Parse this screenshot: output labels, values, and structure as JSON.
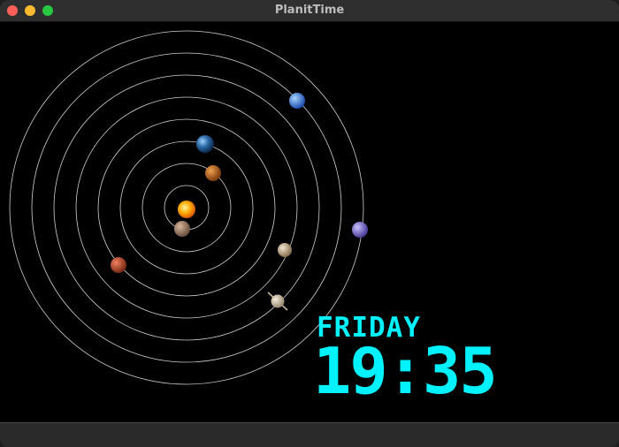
{
  "window": {
    "title": "PlanitTime"
  },
  "clock": {
    "day": "FRIDAY",
    "time": "19:35",
    "color": "#00f2ff"
  },
  "solar_system": {
    "orbit_color": "#d0d0d0",
    "planets": [
      {
        "name": "sun",
        "color": "#ff9d00"
      },
      {
        "name": "mercury",
        "color": "#9b7b63"
      },
      {
        "name": "venus",
        "color": "#c8741e"
      },
      {
        "name": "earth",
        "color": "#3a6ea8"
      },
      {
        "name": "mars",
        "color": "#c4502e"
      },
      {
        "name": "jupiter",
        "color": "#c9b49a"
      },
      {
        "name": "saturn",
        "color": "#d6c7b0"
      },
      {
        "name": "uranus",
        "color": "#8a7fd0"
      },
      {
        "name": "neptune",
        "color": "#4a8ee8"
      }
    ]
  }
}
